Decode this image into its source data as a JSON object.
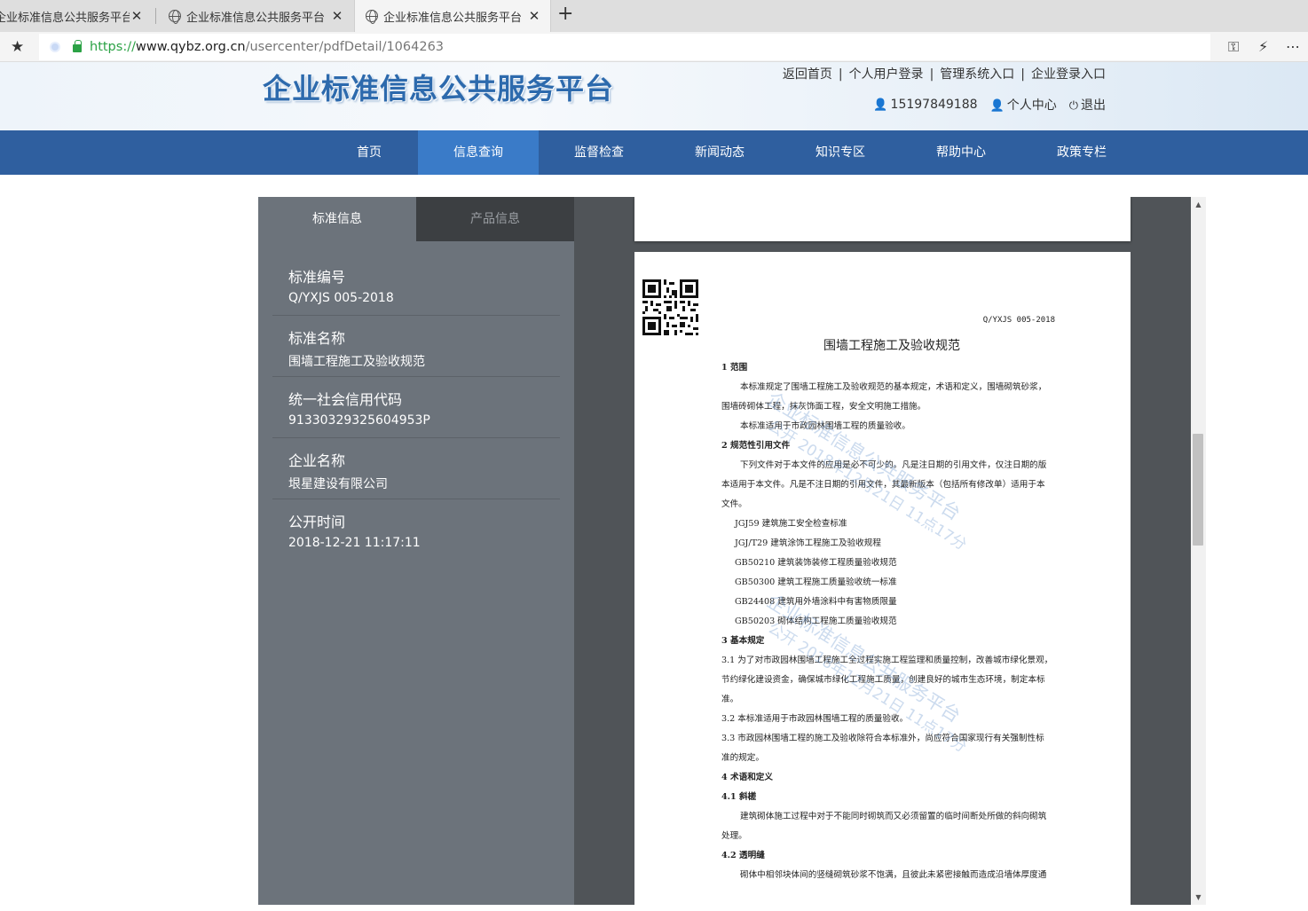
{
  "browser": {
    "tabs": [
      {
        "label": "企业标准信息公共服务平台",
        "active": false
      },
      {
        "label": "企业标准信息公共服务平台",
        "active": false
      },
      {
        "label": "企业标准信息公共服务平台",
        "active": true
      }
    ],
    "tab_close": "✕",
    "new_tab": "+",
    "url": {
      "scheme": "https://",
      "host": "www.qybz.org.cn",
      "path": "/usercenter/pdfDetail/1064263"
    }
  },
  "header": {
    "logo": "企业标准信息公共服务平台",
    "links": [
      "返回首页",
      "个人用户登录",
      "管理系统入口",
      "企业登录入口"
    ],
    "link_sep": "|",
    "phone": "15197849188",
    "center": "个人中心",
    "logout": "退出"
  },
  "nav": {
    "items": [
      "首页",
      "信息查询",
      "监督检查",
      "新闻动态",
      "知识专区",
      "帮助中心",
      "政策专栏"
    ],
    "active_index": 1
  },
  "sidebar": {
    "tabs": [
      "标准信息",
      "产品信息"
    ],
    "fields": [
      {
        "key": "标准编号",
        "value": "Q/YXJS 005-2018"
      },
      {
        "key": "标准名称",
        "value": "围墙工程施工及验收规范"
      },
      {
        "key": "统一社会信用代码",
        "value": "91330329325604953P"
      },
      {
        "key": "企业名称",
        "value": "垠星建设有限公司"
      },
      {
        "key": "公开时间",
        "value": "2018-12-21 11:17:11"
      }
    ]
  },
  "document": {
    "std_no": "Q/YXJS 005-2018",
    "title": "围墙工程施工及验收规范",
    "lines": [
      "1 范围",
      "本标准规定了围墙工程施工及验收规范的基本规定，术语和定义，围墙砌筑砂浆，",
      "围墙砖砌体工程，抹灰饰面工程，安全文明施工措施。",
      "本标准适用于市政园林围墙工程的质量验收。",
      "2 规范性引用文件",
      "下列文件对于本文件的应用是必不可少的。凡是注日期的引用文件，仅注日期的版",
      "本适用于本文件。凡是不注日期的引用文件，其最新版本（包括所有修改单）适用于本",
      "文件。",
      "JGJ59  建筑施工安全检查标准",
      "JGJ/T29  建筑涂饰工程施工及验收规程",
      "GB50210  建筑装饰装修工程质量验收规范",
      "GB50300  建筑工程施工质量验收统一标准",
      "GB24408  建筑用外墙涂料中有害物质限量",
      "GB50203  砌体结构工程施工质量验收规范",
      "3 基本规定",
      "3.1 为了对市政园林围墙工程施工全过程实施工程监理和质量控制，改善城市绿化景观，",
      "节约绿化建设资金，确保城市绿化工程施工质量，创建良好的城市生态环境，制定本标",
      "准。",
      "3.2 本标准适用于市政园林围墙工程的质量验收。",
      "3.3 市政园林围墙工程的施工及验收除符合本标准外，尚应符合国家现行有关强制性标",
      "准的规定。",
      "4 术语和定义",
      "4.1 斜槎",
      "建筑砌体施工过程中对于不能同时砌筑而又必须留置的临时间断处所做的斜向砌筑",
      "处理。",
      "4.2 透明缝",
      "砌体中相邻块体间的竖缝砌筑砂浆不饱满，且彼此未紧密接触而造成沿墙体厚度通"
    ],
    "watermarks": [
      "企业标准信息公共服务平台",
      "公开 2018年12月21日 11点17分",
      "企业标准信息公共服务平台",
      "公开 2018年12月21日 11点17分"
    ]
  },
  "icons": {
    "favorites": "★",
    "key": "⚿",
    "bolt": "⚡",
    "more": "⋯",
    "user": "👤",
    "power": "⏻",
    "scroll_up": "▲",
    "scroll_down": "▼"
  }
}
